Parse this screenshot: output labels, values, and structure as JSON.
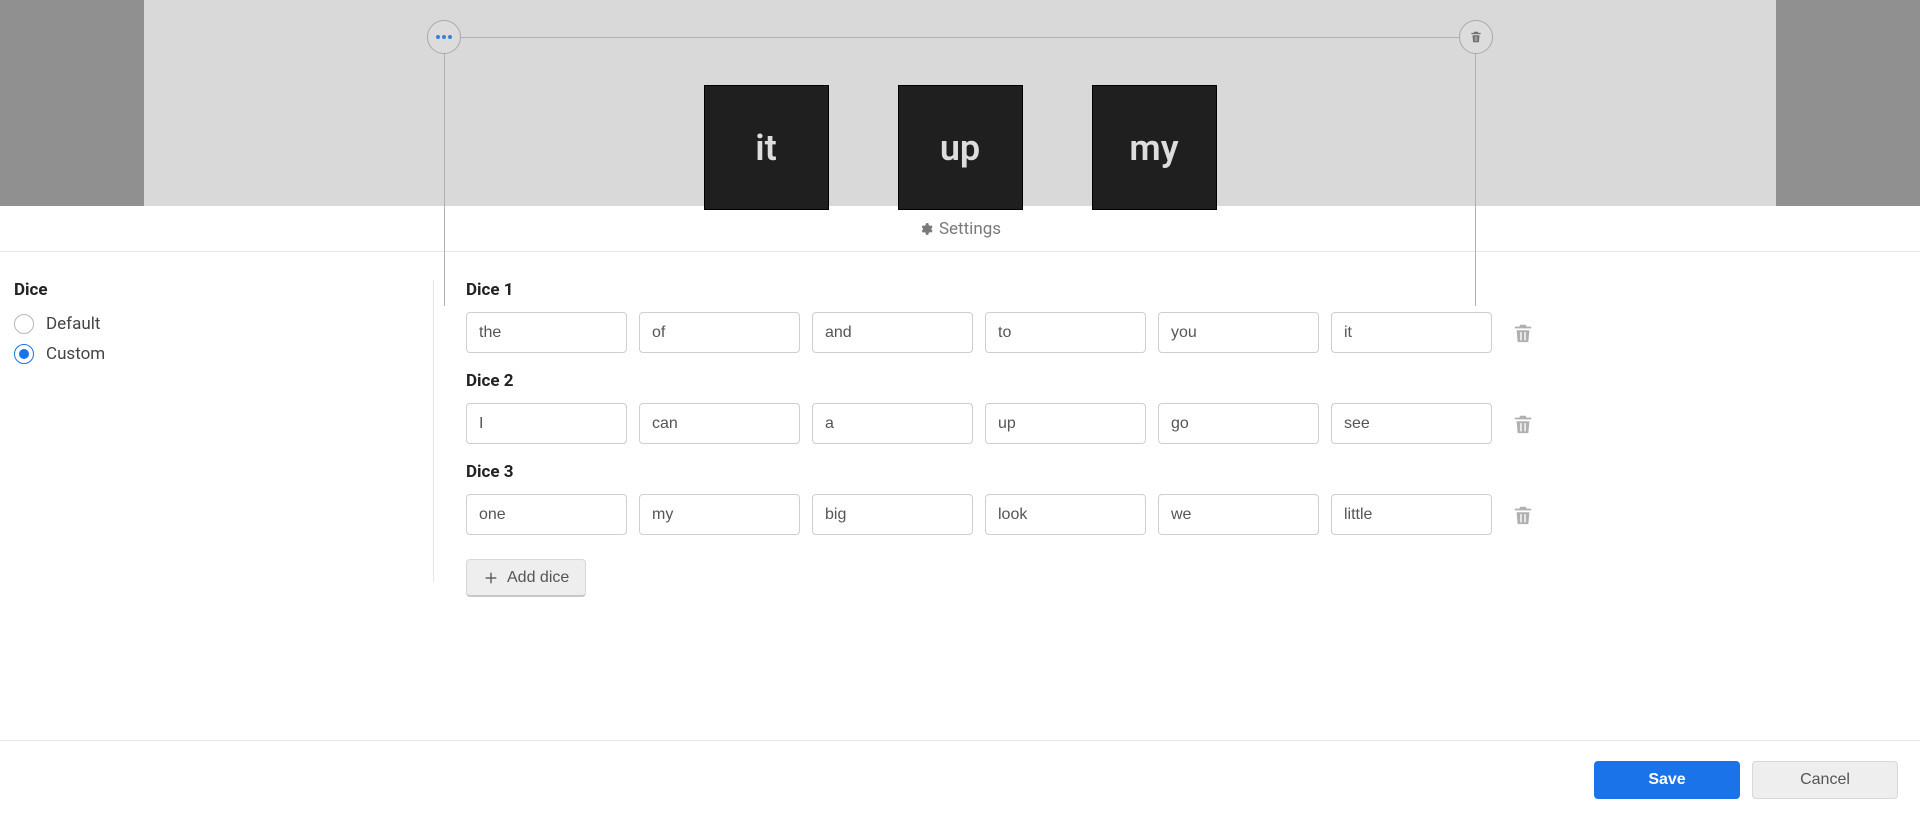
{
  "preview": {
    "faces": [
      "it",
      "up",
      "my"
    ]
  },
  "settings_title": "Settings",
  "sidebar": {
    "title": "Dice",
    "options": {
      "default_label": "Default",
      "custom_label": "Custom"
    },
    "selected": "custom"
  },
  "dice": [
    {
      "title": "Dice 1",
      "faces": [
        "the",
        "of",
        "and",
        "to",
        "you",
        "it"
      ]
    },
    {
      "title": "Dice 2",
      "faces": [
        "I",
        "can",
        "a",
        "up",
        "go",
        "see"
      ]
    },
    {
      "title": "Dice 3",
      "faces": [
        "one",
        "my",
        "big",
        "look",
        "we",
        "little"
      ]
    }
  ],
  "add_dice_label": "Add dice",
  "footer": {
    "save_label": "Save",
    "cancel_label": "Cancel"
  }
}
